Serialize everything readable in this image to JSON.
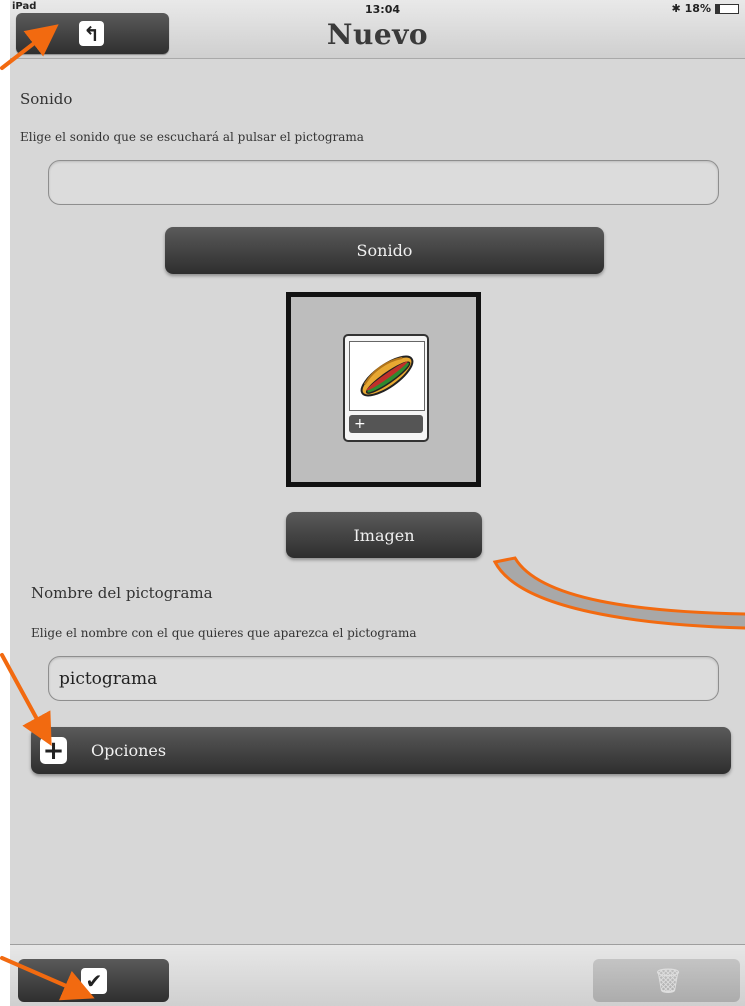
{
  "status_bar": {
    "carrier": "iPad",
    "time": "13:04",
    "battery": "18%"
  },
  "header": {
    "title": "Nuevo",
    "back_icon": "undo-arrow-icon"
  },
  "sound_section": {
    "title": "Sonido",
    "description": "Elige el sonido que se escuchará al pulsar el pictograma",
    "field_value": "",
    "button_label": "Sonido"
  },
  "image_section": {
    "button_label": "Imagen",
    "picto_icon": "sandwich-icon",
    "add_glyph": "+"
  },
  "name_section": {
    "title": "Nombre del pictograma",
    "description": "Elige el nombre con el que quieres que aparezca el pictograma",
    "field_value": "pictograma"
  },
  "options": {
    "label": "Opciones",
    "icon": "plus-icon"
  },
  "bottom_bar": {
    "confirm_icon": "checkmark-icon",
    "delete_icon": "trash-icon"
  },
  "colors": {
    "annotation_arrow": "#f26a10",
    "button_dark": "#3a3a3a",
    "background": "#d7d7d7"
  }
}
